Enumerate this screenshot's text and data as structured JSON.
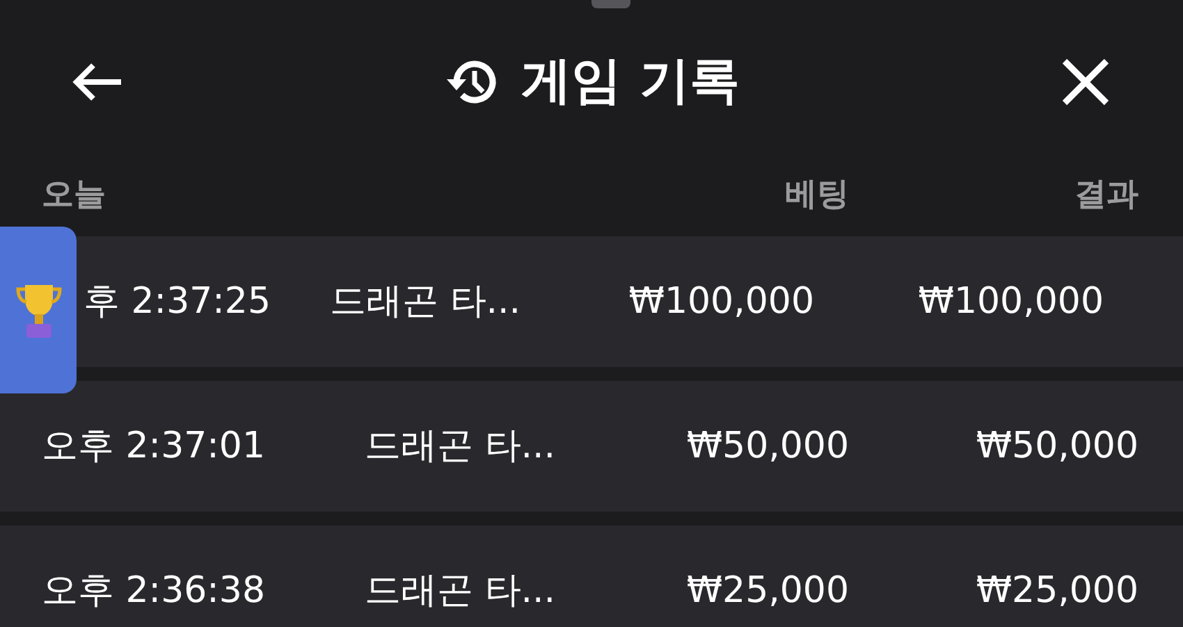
{
  "header": {
    "title": "게임 기록"
  },
  "columns": {
    "date": "오늘",
    "bet": "베팅",
    "result": "결과"
  },
  "floating_badge": {
    "kind": "trophy"
  },
  "rows": [
    {
      "time": "후 2:37:25",
      "game": "드래곤 타...",
      "bet": "₩100,000",
      "result": "₩100,000",
      "covered": true
    },
    {
      "time": "오후 2:37:01",
      "game": "드래곤 타...",
      "bet": "₩50,000",
      "result": "₩50,000",
      "covered": false
    },
    {
      "time": "오후 2:36:38",
      "game": "드래곤 타...",
      "bet": "₩25,000",
      "result": "₩25,000",
      "covered": false
    }
  ]
}
